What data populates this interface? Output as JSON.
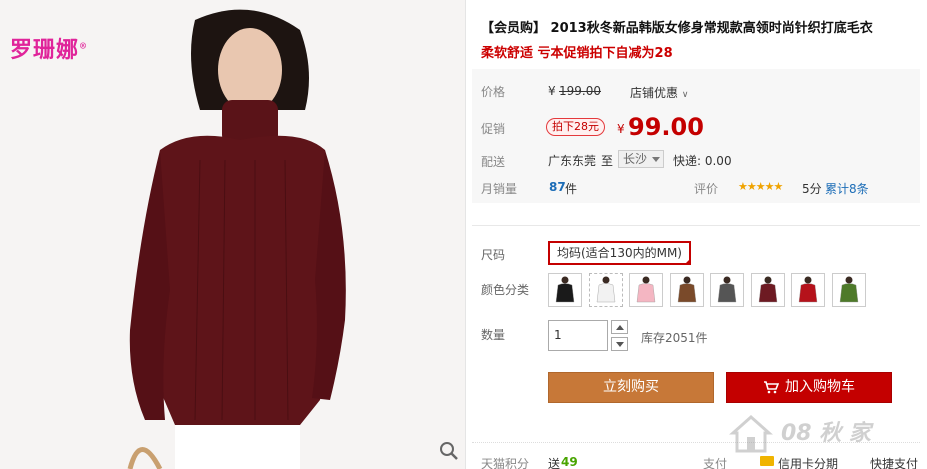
{
  "brand": {
    "logo_text": "罗珊娜",
    "reg_mark": "®"
  },
  "product": {
    "title": "【会员购】 2013秋冬新品韩版女修身常规款高领时尚针织打底毛衣",
    "subtitle": "柔软舒适 亏本促销拍下自减为28"
  },
  "pricing": {
    "list_label": "价格",
    "list_currency": "¥",
    "list_price": "199.00",
    "store_discount_link": "店铺优惠",
    "promo_label": "促销",
    "promo_tag": "拍下28元",
    "promo_currency": "¥",
    "promo_price": "99.00"
  },
  "shipping": {
    "label": "配送",
    "from": "广东东莞",
    "to_word": "至",
    "destination": "长沙",
    "fee_text": "快递: 0.00"
  },
  "sales": {
    "label": "月销量",
    "count": "87",
    "unit": "件",
    "rating_label": "评价",
    "stars": "★★★★★",
    "rating_value": 5,
    "score": "5分",
    "review_link": "累计8条"
  },
  "options": {
    "size_label": "尺码",
    "size_value": "均码(适合130内的MM)",
    "color_label": "颜色分类",
    "swatches": [
      {
        "name": "color-black",
        "color": "#1a1a1a"
      },
      {
        "name": "color-white-dotted",
        "color": "#f2f2f2"
      },
      {
        "name": "color-pink",
        "color": "#f4b6c2"
      },
      {
        "name": "color-brown",
        "color": "#7a4a2a"
      },
      {
        "name": "color-grey",
        "color": "#555555"
      },
      {
        "name": "color-wine-red",
        "color": "#6d1a22"
      },
      {
        "name": "color-red",
        "color": "#b5121b"
      },
      {
        "name": "color-green",
        "color": "#4e7a2a"
      }
    ]
  },
  "quantity": {
    "label": "数量",
    "value": "1",
    "stock_text": "库存2051件"
  },
  "actions": {
    "buy_now": "立刻购买",
    "add_to_cart": "加入购物车"
  },
  "footer": {
    "points_label": "天猫积分",
    "points_prefix": "送",
    "points_value": "49",
    "pay_label": "支付",
    "credit_card_installment": "信用卡分期",
    "express_pay": "快捷支付"
  },
  "watermark": {
    "text": "08 秋 家"
  },
  "colors": {
    "accent_red": "#c40000",
    "buy_orange": "#c77838",
    "logo_pink": "#e0249a",
    "sweater": "#5e1419"
  }
}
